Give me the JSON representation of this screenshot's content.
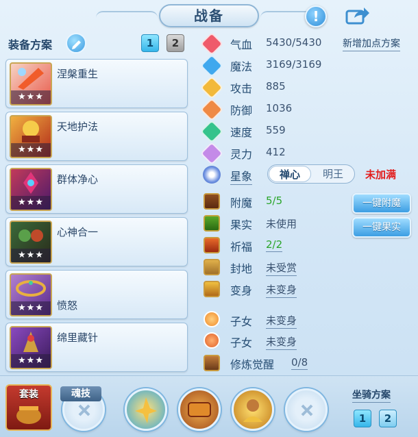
{
  "header": {
    "title": "战备",
    "info_label": "!"
  },
  "plans": {
    "label": "装备方案",
    "tabs": [
      "1",
      "2"
    ],
    "active_tab": "1"
  },
  "skills": [
    {
      "name": "涅槃重生",
      "stars": "★★★",
      "color": "#e85a4a"
    },
    {
      "name": "天地护法",
      "stars": "★★★",
      "color": "#c83a2a"
    },
    {
      "name": "群体净心",
      "stars": "★★★",
      "color": "#b02040"
    },
    {
      "name": "心神合一",
      "stars": "★★★",
      "color": "#6a3a1a"
    },
    {
      "name": "愤怒",
      "stars": "★★★",
      "color": "#8a4aa0"
    },
    {
      "name": "绵里藏针",
      "stars": "★★★",
      "color": "#5a2a8a"
    }
  ],
  "stats": [
    {
      "label": "气血",
      "value": "5430/5430",
      "icon": "heart-icon",
      "color": "#ef5a6a"
    },
    {
      "label": "魔法",
      "value": "3169/3169",
      "icon": "magic-drop-icon",
      "color": "#3fa8ee"
    },
    {
      "label": "攻击",
      "value": "885",
      "icon": "sword-icon",
      "color": "#f2b93a"
    },
    {
      "label": "防御",
      "value": "1036",
      "icon": "shield-icon",
      "color": "#ef8a45"
    },
    {
      "label": "速度",
      "value": "559",
      "icon": "lightning-icon",
      "color": "#35c38c"
    },
    {
      "label": "灵力",
      "value": "412",
      "icon": "spirit-icon",
      "color": "#c48ae8"
    }
  ],
  "add_points_label": "新增加点方案",
  "star": {
    "label": "星象",
    "options": [
      "禅心",
      "明王"
    ],
    "selected": "禅心",
    "status": "未加满",
    "status_color": "#e31b1b"
  },
  "extras": [
    {
      "label": "附魔",
      "value": "5/5",
      "green": true,
      "underline": false
    },
    {
      "label": "果实",
      "value": "未使用",
      "green": false,
      "underline": false
    },
    {
      "label": "祈福",
      "value": "2/2",
      "green": true,
      "underline": true
    },
    {
      "label": "封地",
      "value": "未受赏",
      "green": false,
      "underline": true
    },
    {
      "label": "变身",
      "value": "未变身",
      "green": false,
      "underline": true
    },
    {
      "label": "子女",
      "value": "未变身",
      "green": false,
      "underline": true
    },
    {
      "label": "子女",
      "value": "未变身",
      "green": false,
      "underline": true
    },
    {
      "label": "修炼觉醒",
      "value": "0/8",
      "green": false,
      "underline": true
    }
  ],
  "buttons": {
    "enchant": "一键附魔",
    "fruit": "一键果实"
  },
  "bottom": {
    "suit_label": "套装",
    "soul_label": "魂技",
    "mount_label": "坐骑方案",
    "mount_tabs": [
      "1",
      "2"
    ]
  }
}
